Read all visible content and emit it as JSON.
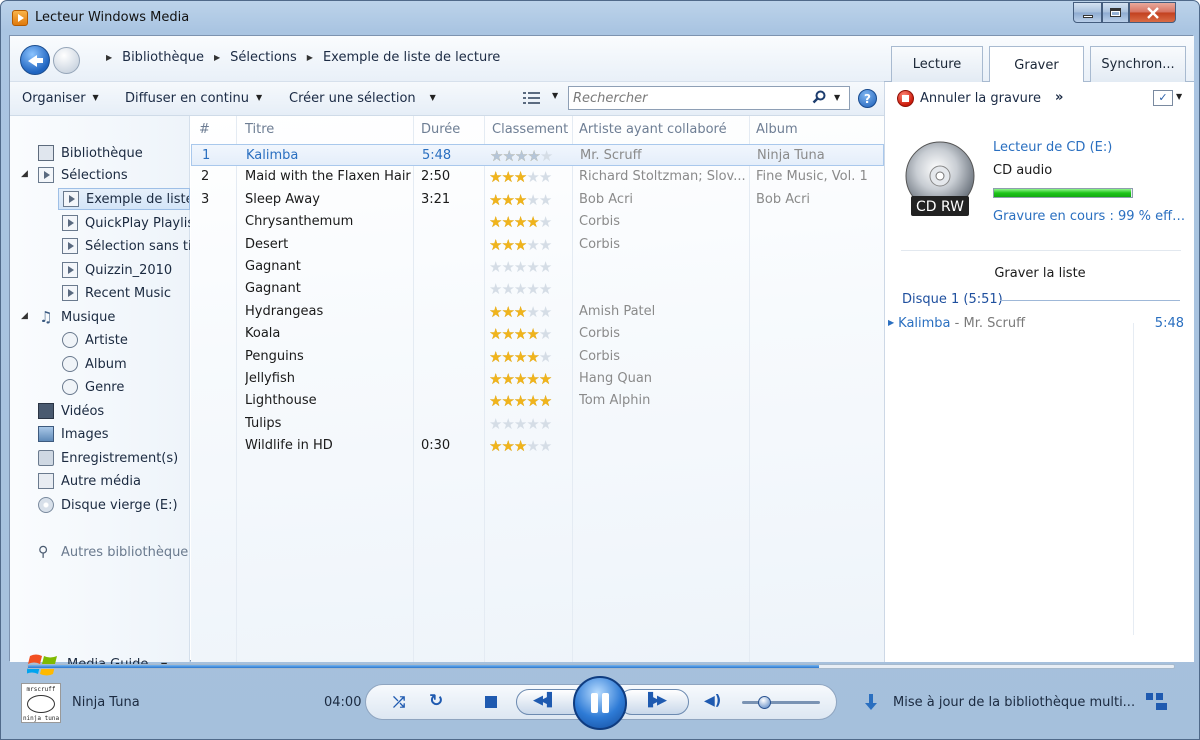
{
  "window": {
    "title": "Lecteur Windows Media"
  },
  "breadcrumb": [
    "Bibliothèque",
    "Sélections",
    "Exemple de liste de lecture"
  ],
  "tabs": [
    {
      "label": "Lecture",
      "active": false
    },
    {
      "label": "Graver",
      "active": true
    },
    {
      "label": "Synchron...",
      "active": false
    }
  ],
  "toolbar": {
    "organize": "Organiser",
    "stream": "Diffuser en continu",
    "create": "Créer une sélection",
    "search_placeholder": "Rechercher"
  },
  "burn_toolbar": {
    "cancel": "Annuler la gravure",
    "more": "»"
  },
  "nav": {
    "library": "Bibliothèque",
    "playlists": "Sélections",
    "playlist_items": [
      "Exemple de liste de lecture",
      "QuickPlay Playlist",
      "Sélection sans titre",
      "Quizzin_2010",
      "Recent Music"
    ],
    "music": "Musique",
    "music_items": [
      "Artiste",
      "Album",
      "Genre"
    ],
    "videos": "Vidéos",
    "images": "Images",
    "recordings": "Enregistrement(s)",
    "other_media": "Autre média",
    "blank_disc": "Disque vierge (E:)",
    "other_libraries": "Autres bibliothèques",
    "media_guide": "Media Guide"
  },
  "columns": {
    "num": "#",
    "title": "Titre",
    "duration": "Durée",
    "rating": "Classement",
    "artist": "Artiste ayant collaboré",
    "album": "Album"
  },
  "tracks": [
    {
      "num": "1",
      "title": "Kalimba",
      "duration": "5:48",
      "rating": 3.5,
      "artist": "Mr. Scruff",
      "album": "Ninja Tuna",
      "selected": true
    },
    {
      "num": "2",
      "title": "Maid with the Flaxen Hair",
      "duration": "2:50",
      "rating": 3,
      "artist": "Richard Stoltzman; Slov...",
      "album": "Fine Music, Vol. 1",
      "selected": false
    },
    {
      "num": "3",
      "title": "Sleep Away",
      "duration": "3:21",
      "rating": 3,
      "artist": "Bob Acri",
      "album": "Bob Acri",
      "selected": false
    },
    {
      "num": "",
      "title": "Chrysanthemum",
      "duration": "",
      "rating": 4,
      "artist": "Corbis",
      "album": "",
      "selected": false
    },
    {
      "num": "",
      "title": "Desert",
      "duration": "",
      "rating": 3,
      "artist": "Corbis",
      "album": "",
      "selected": false
    },
    {
      "num": "",
      "title": "Gagnant",
      "duration": "",
      "rating": 0,
      "artist": "",
      "album": "",
      "selected": false
    },
    {
      "num": "",
      "title": "Gagnant",
      "duration": "",
      "rating": 0,
      "artist": "",
      "album": "",
      "selected": false
    },
    {
      "num": "",
      "title": "Hydrangeas",
      "duration": "",
      "rating": 3,
      "artist": "Amish Patel",
      "album": "",
      "selected": false
    },
    {
      "num": "",
      "title": "Koala",
      "duration": "",
      "rating": 4,
      "artist": "Corbis",
      "album": "",
      "selected": false
    },
    {
      "num": "",
      "title": "Penguins",
      "duration": "",
      "rating": 4,
      "artist": "Corbis",
      "album": "",
      "selected": false
    },
    {
      "num": "",
      "title": "Jellyfish",
      "duration": "",
      "rating": 5,
      "artist": "Hang Quan",
      "album": "",
      "selected": false
    },
    {
      "num": "",
      "title": "Lighthouse",
      "duration": "",
      "rating": 5,
      "artist": "Tom Alphin",
      "album": "",
      "selected": false
    },
    {
      "num": "",
      "title": "Tulips",
      "duration": "",
      "rating": 0,
      "artist": "",
      "album": "",
      "selected": false
    },
    {
      "num": "",
      "title": "Wildlife in HD",
      "duration": "0:30",
      "rating": 3,
      "artist": "",
      "album": "",
      "selected": false
    }
  ],
  "burn": {
    "drive": "Lecteur de CD (E:)",
    "disc_type": "CD audio",
    "progress": 0.99,
    "status": "Gravure en cours : 99 % effe...",
    "list_title": "Graver la liste",
    "disc_label": "Disque 1 (5:51)",
    "item_title": "Kalimba",
    "item_artist": " - Mr. Scruff",
    "item_duration": "5:48",
    "cd_label": "CD RW"
  },
  "player": {
    "album_art_text_top": "mrscruff",
    "album_art_text_bottom": "ninja tuna",
    "now_playing": "Ninja Tuna",
    "time": "04:00",
    "seek_progress": 0.69,
    "volume": 0.3,
    "status": "Mise à jour de la bibliothèque multi..."
  }
}
